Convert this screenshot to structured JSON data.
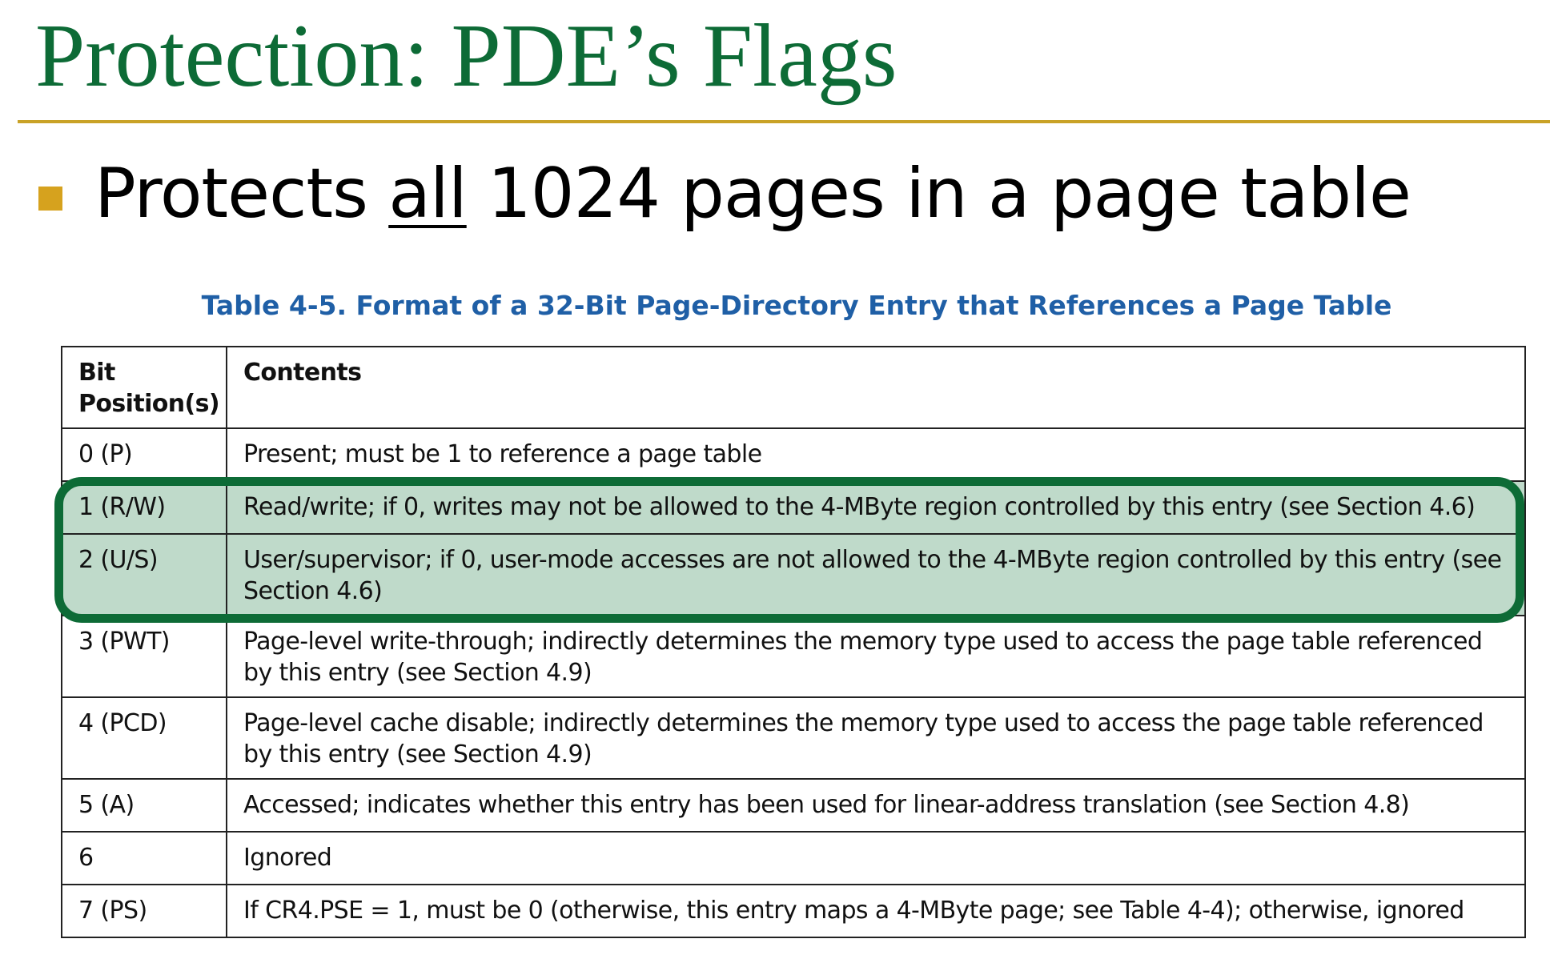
{
  "slide": {
    "title": "Protection: PDE’s Flags",
    "bullet": {
      "before": "Protects ",
      "emphasis": "all",
      "after": " 1024 pages in a page table"
    }
  },
  "table": {
    "caption": "Table 4-5.  Format of a 32-Bit Page-Directory Entry that References a Page Table",
    "headers": [
      "Bit Position(s)",
      "Contents"
    ],
    "rows": [
      {
        "bit": "0 (P)",
        "contents": "Present; must be 1 to reference a page table"
      },
      {
        "bit": "1 (R/W)",
        "contents": "Read/write; if 0, writes may not be allowed to the 4-MByte region controlled by this entry (see Section 4.6)"
      },
      {
        "bit": "2 (U/S)",
        "contents": "User/supervisor; if 0, user-mode accesses are not allowed to the 4-MByte region controlled by this entry (see Section 4.6)"
      },
      {
        "bit": "3 (PWT)",
        "contents": "Page-level write-through; indirectly determines the memory type used to access the page table referenced by this entry (see Section 4.9)"
      },
      {
        "bit": "4 (PCD)",
        "contents": "Page-level cache disable; indirectly determines the memory type used to access the page table referenced by this entry (see Section 4.9)"
      },
      {
        "bit": "5 (A)",
        "contents": "Accessed; indicates whether this entry has been used for linear-address translation (see Section 4.8)"
      },
      {
        "bit": "6",
        "contents": "Ignored"
      },
      {
        "bit": "7 (PS)",
        "contents": "If CR4.PSE = 1, must be 0 (otherwise, this entry maps a 4-MByte page; see Table 4-4); otherwise, ignored"
      }
    ]
  },
  "colors": {
    "title_green": "#0d6b36",
    "rule_gold": "#c9a227",
    "bullet_gold": "#d6a21e",
    "caption_blue": "#1f5fa6",
    "highlight_fill": "#bfdaca",
    "highlight_border": "#0d6b36"
  }
}
